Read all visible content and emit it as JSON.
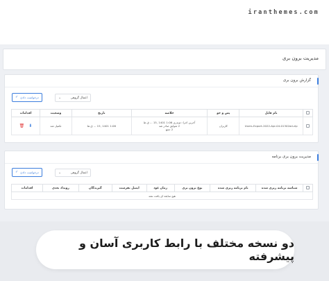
{
  "watermark": "iranthemes.com",
  "header": {
    "title": "مدیریت برون بری"
  },
  "export_report": {
    "title": "گزارش برون بری",
    "request_button": "درخواست دادن",
    "group_action": "اعمال گروهی",
    "columns": [
      "نام فایل",
      "پس و جو",
      "خلاصه",
      "تاریخ",
      "وضعیت",
      "اقدامات"
    ],
    "rows": [
      {
        "file_name": "Users-Export-2022-Apr-04-01302ad.zip",
        "query": "کاربران",
        "summary_lines": [
          "آخرین اجرا: دوبدری 1:06 1401 ,15 ... ق.ظ",
          "2 شوایق صادر شد",
          "2 جمع"
        ],
        "date": "1:06 1401 ,15 ... ق.ظ",
        "status": "تکمیل شد"
      }
    ]
  },
  "export_programs": {
    "title": "مدیریت برون بری برنامه",
    "request_button": "درخواست دادن",
    "group_action": "اعمال گروهی",
    "columns": [
      "شناسه برنامه ریزی شده",
      "نام برنامه ریزی شده",
      "نوع برون بری",
      "زمان عود",
      "ایمیل بفرست",
      "گیرندگان",
      "رویداد بعدی",
      "اقدامات"
    ],
    "empty_text": "هیچ سابقه ای یافت نشد"
  },
  "banner": {
    "text": "دو نسخه مختلف با رابط کاربری آسان و پیشرفته"
  }
}
